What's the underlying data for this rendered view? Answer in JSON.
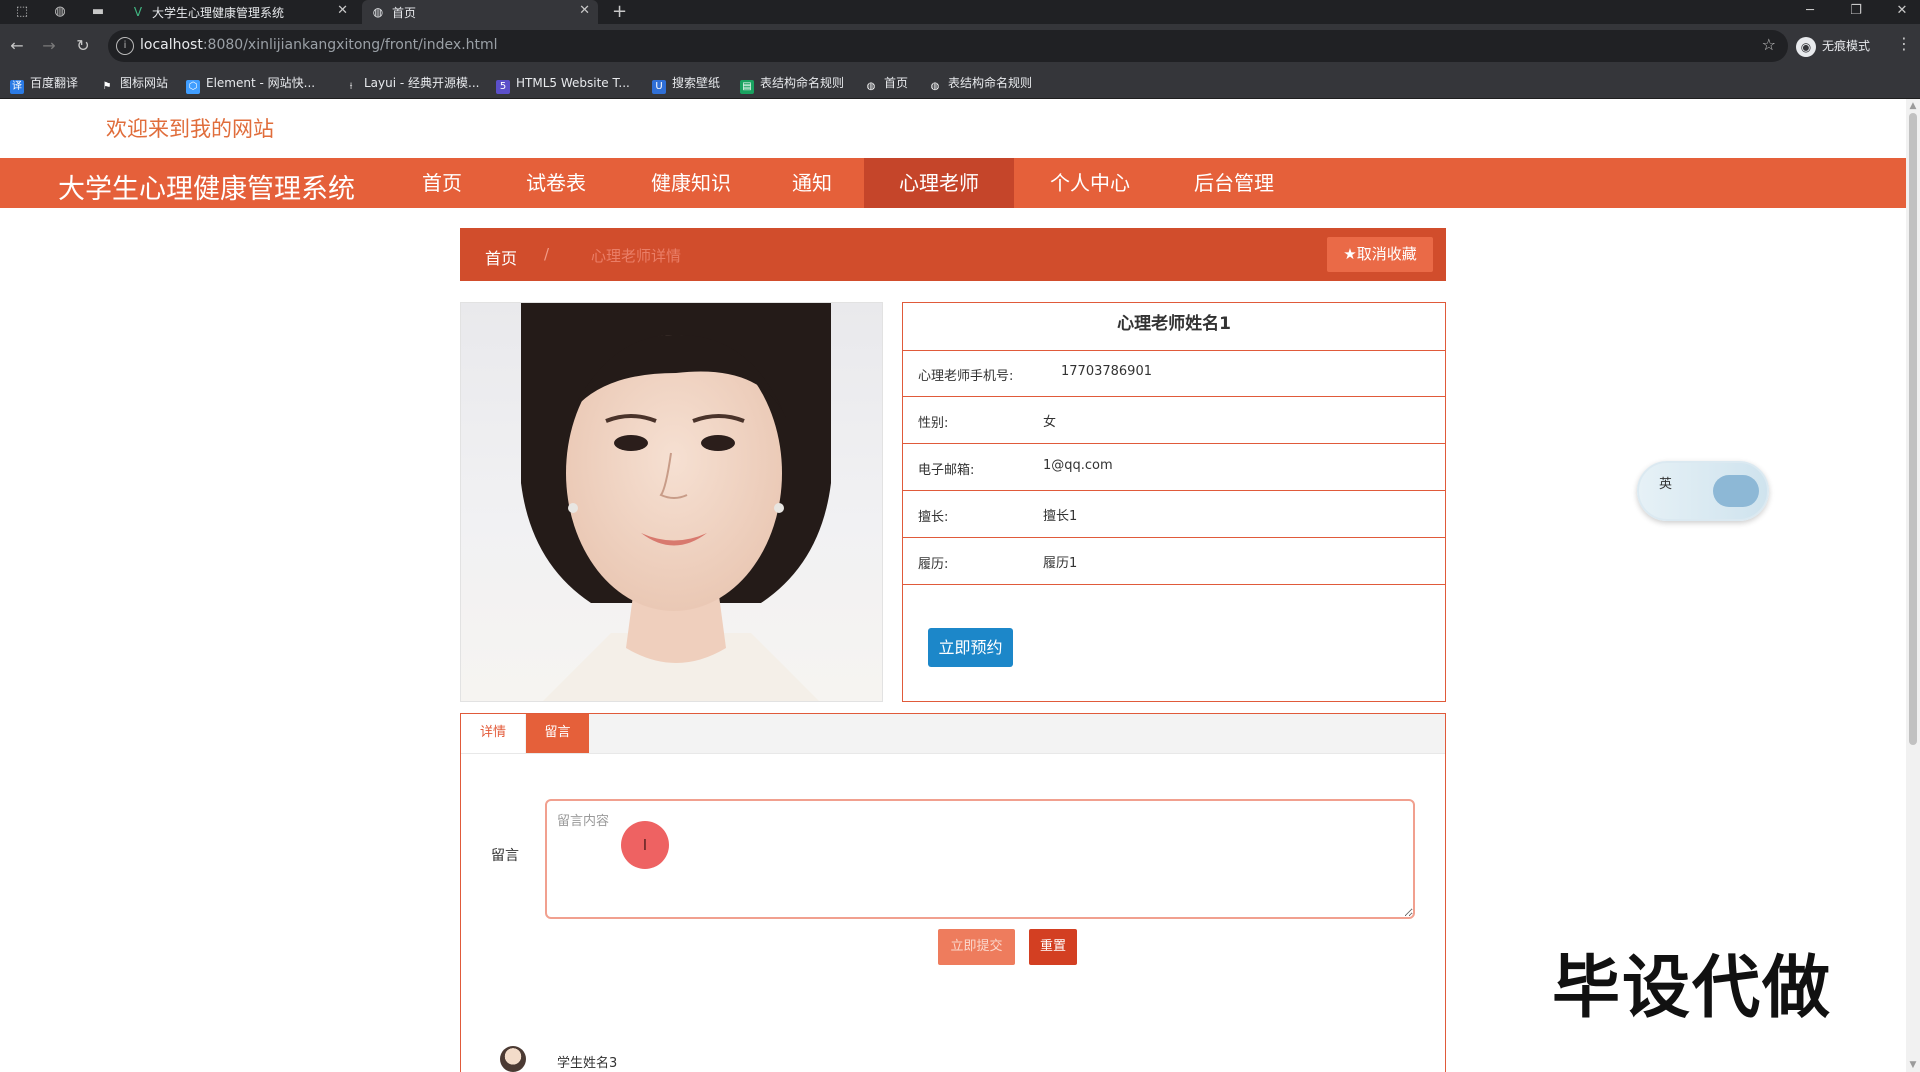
{
  "browser": {
    "tabs": [
      {
        "title": "大学生心理健康管理系统",
        "icon": "vue-logo-icon",
        "active": false
      },
      {
        "title": "首页",
        "icon": "globe-icon",
        "active": true
      }
    ],
    "url_host": "localhost",
    "url_path": ":8080/xinlijiankangxitong/front/index.html",
    "incognito_label": "无痕模式",
    "bookmarks": [
      {
        "label": "百度翻译",
        "icon": "baidu-translate-icon"
      },
      {
        "label": "图标网站",
        "icon": "flag-icon"
      },
      {
        "label": "Element - 网站快...",
        "icon": "element-icon"
      },
      {
        "label": "Layui - 经典开源模...",
        "icon": "layui-icon"
      },
      {
        "label": "HTML5 Website T...",
        "icon": "html5-icon"
      },
      {
        "label": "搜索壁纸",
        "icon": "wallpaper-icon"
      },
      {
        "label": "表结构命名规则",
        "icon": "sheet-icon"
      },
      {
        "label": "首页",
        "icon": "globe-icon"
      },
      {
        "label": "表结构命名规则",
        "icon": "globe-icon"
      }
    ]
  },
  "header": {
    "welcome": "欢迎来到我的网站"
  },
  "nav": {
    "brand": "大学生心理健康管理系统",
    "items": [
      {
        "label": "首页",
        "active": false
      },
      {
        "label": "试卷表",
        "active": false
      },
      {
        "label": "健康知识",
        "active": false
      },
      {
        "label": "通知",
        "active": false
      },
      {
        "label": "心理老师",
        "active": true
      },
      {
        "label": "个人中心",
        "active": false
      },
      {
        "label": "后台管理",
        "active": false
      }
    ],
    "accent": "#e5603a",
    "active_color": "#c5452a"
  },
  "breadcrumb": {
    "home": "首页",
    "separator": "/",
    "current": "心理老师详情",
    "unfavorite_label": "取消收藏"
  },
  "teacher": {
    "name": "心理老师姓名1",
    "fields": [
      {
        "label": "心理老师手机号:",
        "value": "17703786901"
      },
      {
        "label": "性别:",
        "value": "女"
      },
      {
        "label": "电子邮箱:",
        "value": "1@qq.com"
      },
      {
        "label": "擅长:",
        "value": "擅长1"
      },
      {
        "label": "履历:",
        "value": "履历1"
      }
    ],
    "book_button": "立即预约"
  },
  "tabs": {
    "detail": "详情",
    "message": "留言"
  },
  "message_form": {
    "label": "留言",
    "placeholder": "留言内容",
    "submit": "立即提交",
    "reset": "重置"
  },
  "comments": [
    {
      "author": "学生姓名3"
    }
  ],
  "overlays": {
    "ime_label": "英",
    "watermark": "毕设代做"
  }
}
